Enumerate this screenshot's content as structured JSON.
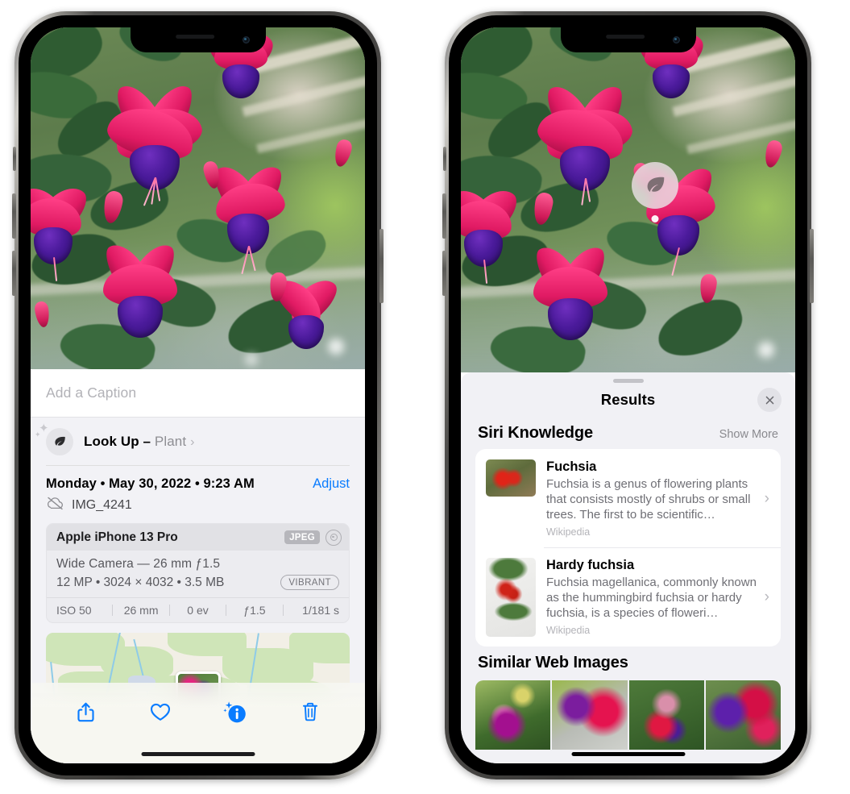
{
  "left_phone": {
    "photo": {
      "alt": "fuchsia-flowers-photo"
    },
    "caption_placeholder": "Add a Caption",
    "lookup": {
      "label": "Look Up",
      "dash": " – ",
      "subject": "Plant",
      "chevron": "›",
      "icon": "leaf-icon"
    },
    "meta": {
      "date": "Monday • May 30, 2022 • 9:23 AM",
      "adjust": "Adjust",
      "filename": "IMG_4241",
      "cloud_icon": "cloud-slash-icon"
    },
    "exif": {
      "device": "Apple iPhone 13 Pro",
      "format_badge": "JPEG",
      "aperture_icon": "aperture-icon",
      "lens_line": "Wide Camera — 26 mm ƒ1.5",
      "size_line": "12 MP • 3024 × 4032 • 3.5 MB",
      "style_badge": "VIBRANT",
      "stats": [
        "ISO 50",
        "26 mm",
        "0 ev",
        "ƒ1.5",
        "1/181 s"
      ]
    },
    "map": {
      "name": "location-map"
    },
    "toolbar": [
      {
        "name": "share-button",
        "icon": "share-icon"
      },
      {
        "name": "favorite-button",
        "icon": "heart-icon"
      },
      {
        "name": "info-button",
        "icon": "info-sparkle-icon"
      },
      {
        "name": "delete-button",
        "icon": "trash-icon"
      }
    ],
    "accent_color": "#0a7cff"
  },
  "right_phone": {
    "badge": {
      "name": "visual-lookup-leaf-badge",
      "icon": "leaf-icon"
    },
    "results": {
      "title": "Results",
      "close_icon": "close-icon",
      "sections": [
        {
          "title": "Siri Knowledge",
          "action": "Show More",
          "items": [
            {
              "title": "Fuchsia",
              "description": "Fuchsia is a genus of flowering plants that consists mostly of shrubs or small trees. The first to be scientific…",
              "source": "Wikipedia",
              "chevron": "›"
            },
            {
              "title": "Hardy fuchsia",
              "description": "Fuchsia magellanica, commonly known as the hummingbird fuchsia or hardy fuchsia, is a species of floweri…",
              "source": "Wikipedia",
              "chevron": "›"
            }
          ]
        },
        {
          "title": "Similar Web Images",
          "thumbs": [
            "web-image-1",
            "web-image-2",
            "web-image-3",
            "web-image-4"
          ]
        }
      ]
    }
  }
}
